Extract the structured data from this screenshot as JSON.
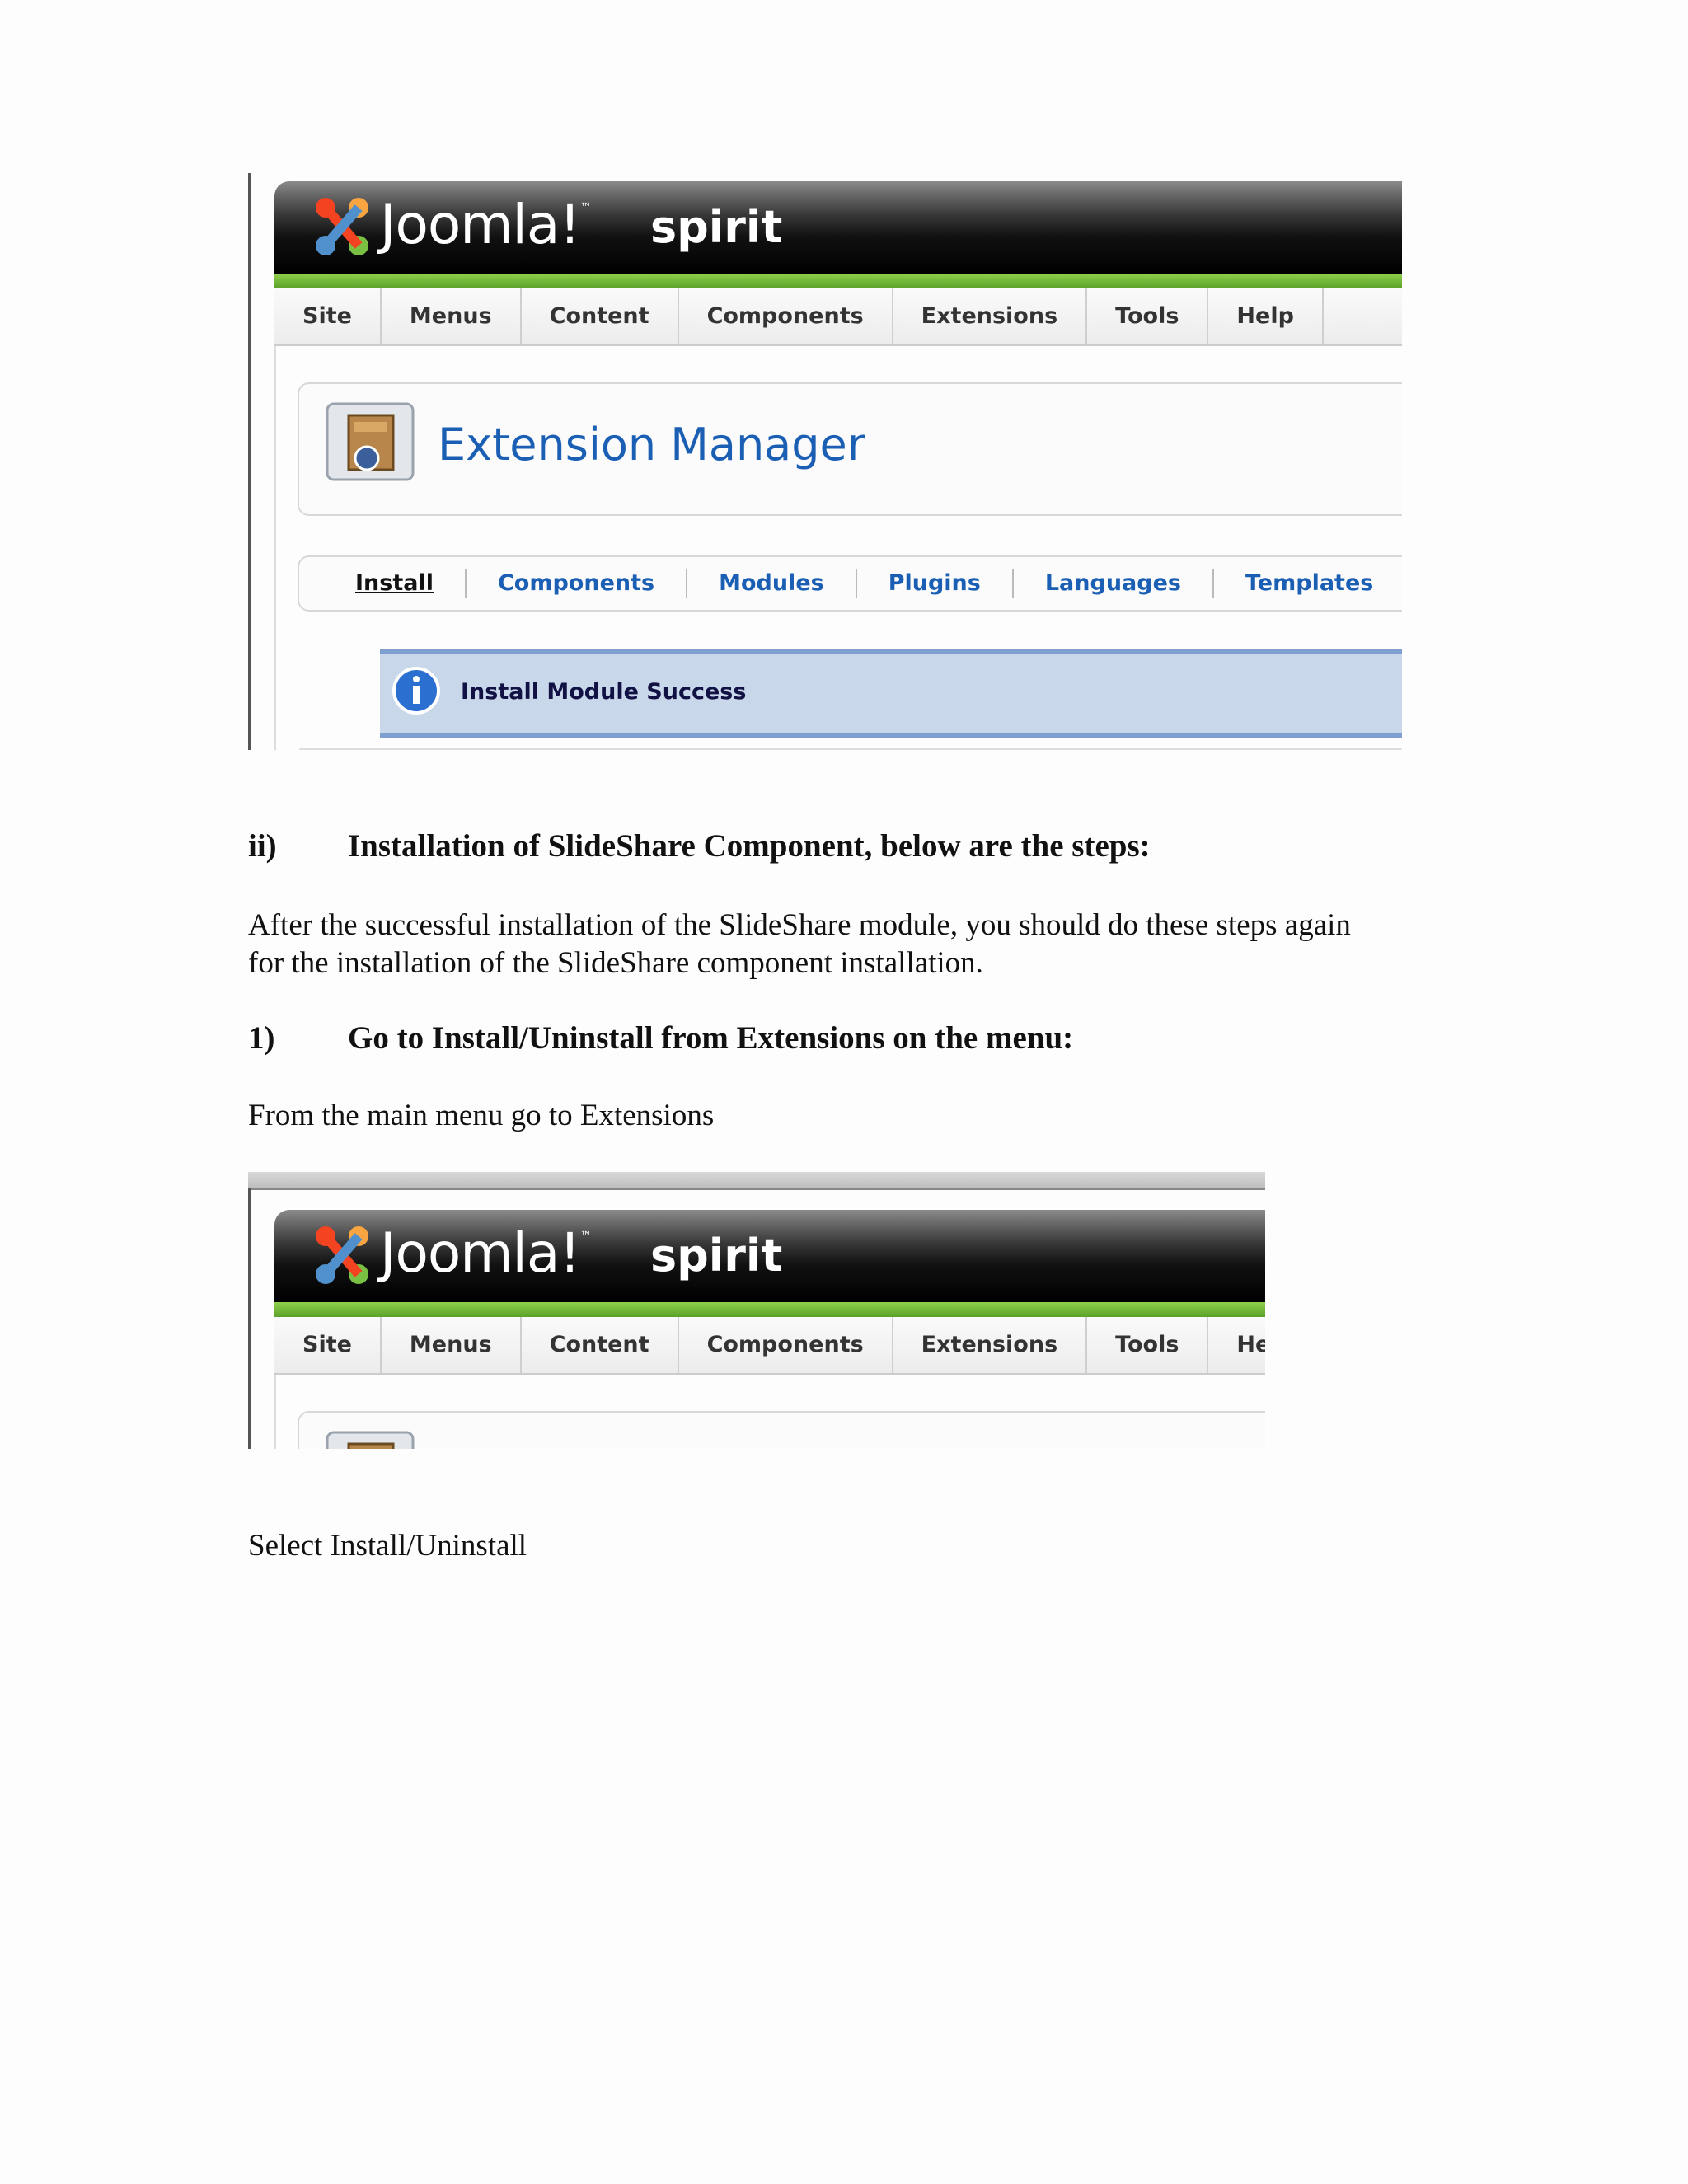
{
  "screenshot1": {
    "brand": "Joomla!",
    "brand_tm": "™",
    "brand_edition": "spirit",
    "menu": [
      "Site",
      "Menus",
      "Content",
      "Components",
      "Extensions",
      "Tools",
      "Help"
    ],
    "title": "Extension Manager",
    "tabs": [
      "Install",
      "Components",
      "Modules",
      "Plugins",
      "Languages",
      "Templates"
    ],
    "active_tab": "Install",
    "message": "Install Module Success"
  },
  "section_ii": {
    "number": "ii)",
    "heading": "Installation of SlideShare Component, below are the steps:",
    "paragraph": "After the successful installation of the SlideShare module, you should do these steps again for the installation of the SlideShare component installation."
  },
  "step_1": {
    "number": "1)",
    "heading": "Go to Install/Uninstall from Extensions on the menu:",
    "paragraph": "From the main menu go to Extensions"
  },
  "screenshot2": {
    "brand": "Joomla!",
    "brand_tm": "™",
    "brand_edition": "spirit",
    "menu": [
      "Site",
      "Menus",
      "Content",
      "Components",
      "Extensions",
      "Tools",
      "Help"
    ]
  },
  "closing_text": "Select Install/Uninstall",
  "colors": {
    "link_blue": "#1a5fb4",
    "green_bar": "#6db33f",
    "message_bg": "#c9d7ea"
  }
}
